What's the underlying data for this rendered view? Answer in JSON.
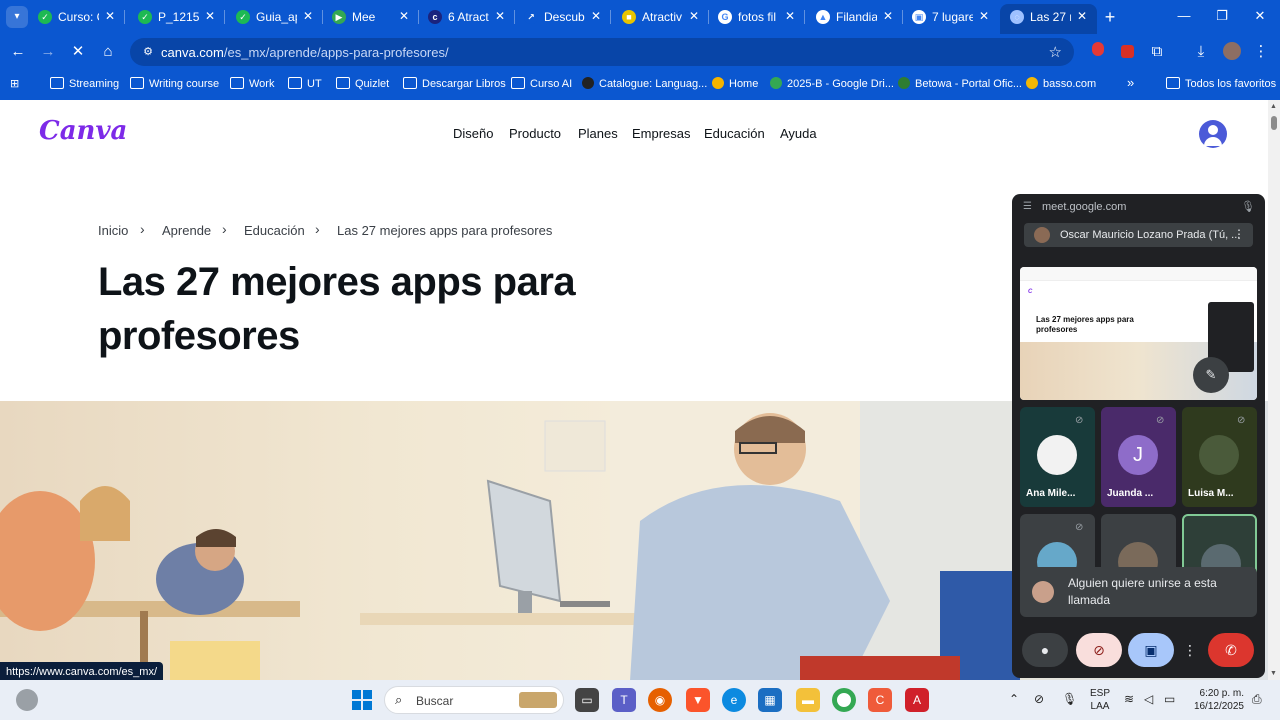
{
  "tabs": [
    {
      "title": "Curso: C",
      "fav_color": "#1db954",
      "fav_glyph": "✓"
    },
    {
      "title": "P_1215",
      "fav_color": "#1db954",
      "fav_glyph": "✓"
    },
    {
      "title": "Guia_ap",
      "fav_color": "#1db954",
      "fav_glyph": "✓"
    },
    {
      "title": "Mee",
      "fav_color": "#34a853",
      "fav_glyph": "▶"
    },
    {
      "title": "6 Atract",
      "fav_color": "#1a237e",
      "fav_glyph": "c"
    },
    {
      "title": "Descubr",
      "fav_color": "#0b57d0",
      "fav_glyph": "↗"
    },
    {
      "title": "Atractiv",
      "fav_color": "#e8c400",
      "fav_glyph": "■"
    },
    {
      "title": "fotos fil",
      "fav_color": "#ffffff",
      "fav_glyph": "G"
    },
    {
      "title": "Filandia",
      "fav_color": "#ffffff",
      "fav_glyph": "▲"
    },
    {
      "title": "7 lugare",
      "fav_color": "#ffffff",
      "fav_glyph": "▣"
    },
    {
      "title": "Las 27 m",
      "fav_color": "#9ec1ff",
      "fav_glyph": "◌"
    }
  ],
  "window": {
    "minimize": "—",
    "maximize": "❐",
    "close": "✕"
  },
  "toolbar": {
    "url_host": "canva.com",
    "url_path": "/es_mx/aprende/apps-para-profesores/"
  },
  "bookmarks": [
    {
      "label": "Streaming",
      "type": "folder"
    },
    {
      "label": "Writing course",
      "type": "folder"
    },
    {
      "label": "Work",
      "type": "folder"
    },
    {
      "label": "UT",
      "type": "folder"
    },
    {
      "label": "Quizlet",
      "type": "folder"
    },
    {
      "label": "Descargar Libros",
      "type": "folder"
    },
    {
      "label": "Curso AI",
      "type": "folder"
    },
    {
      "label": "Catalogue: Languag...",
      "type": "site"
    },
    {
      "label": "Home",
      "type": "site"
    },
    {
      "label": "2025-B - Google Dri...",
      "type": "site"
    },
    {
      "label": "Betowa - Portal Ofic...",
      "type": "site"
    },
    {
      "label": "basso.com",
      "type": "site"
    },
    {
      "label": "Todos los favoritos",
      "type": "folder"
    }
  ],
  "canva": {
    "logo": "Canva",
    "nav": [
      "Diseño",
      "Producto",
      "Planes",
      "Empresas",
      "Educación",
      "Ayuda"
    ],
    "breadcrumb": [
      "Inicio",
      "Aprende",
      "Educación",
      "Las 27 mejores apps para profesores"
    ],
    "title": "Las 27 mejores apps para profesores"
  },
  "meet": {
    "url": "meet.google.com",
    "presenter": "Oscar Mauricio Lozano Prada (Tú, ...",
    "shared_title": "Las 27 mejores apps para profesores",
    "participants": [
      {
        "name": "Ana Mile...",
        "bg": "#183a3a",
        "avatar": "#f2f2f2"
      },
      {
        "name": "Juanda ...",
        "bg": "#4a2a6a",
        "avatar": "#8e6cc9",
        "initial": "J"
      },
      {
        "name": "Luisa M...",
        "bg": "#2f3a1e",
        "avatar": "#4a5a3a"
      },
      {
        "name": "",
        "bg": "#3c4043",
        "avatar": "#66a8c9"
      },
      {
        "name": "",
        "bg": "#3c4043",
        "avatar": "#7a6a5a"
      },
      {
        "name": "",
        "bg": "#2e3f38",
        "avatar": "#5a6a70"
      }
    ],
    "join_toast": "Alguien quiere unirse a esta llamada",
    "controls": {
      "mic": "🎤",
      "cam": "📷",
      "share": "⇪",
      "more": "⋮",
      "hangup": "☎"
    }
  },
  "status_url": "https://www.canva.com/es_mx/",
  "taskbar": {
    "search": "Buscar",
    "lang_line1": "ESP",
    "lang_line2": "LAA",
    "time": "6:20 p. m.",
    "date": "16/12/2025"
  }
}
